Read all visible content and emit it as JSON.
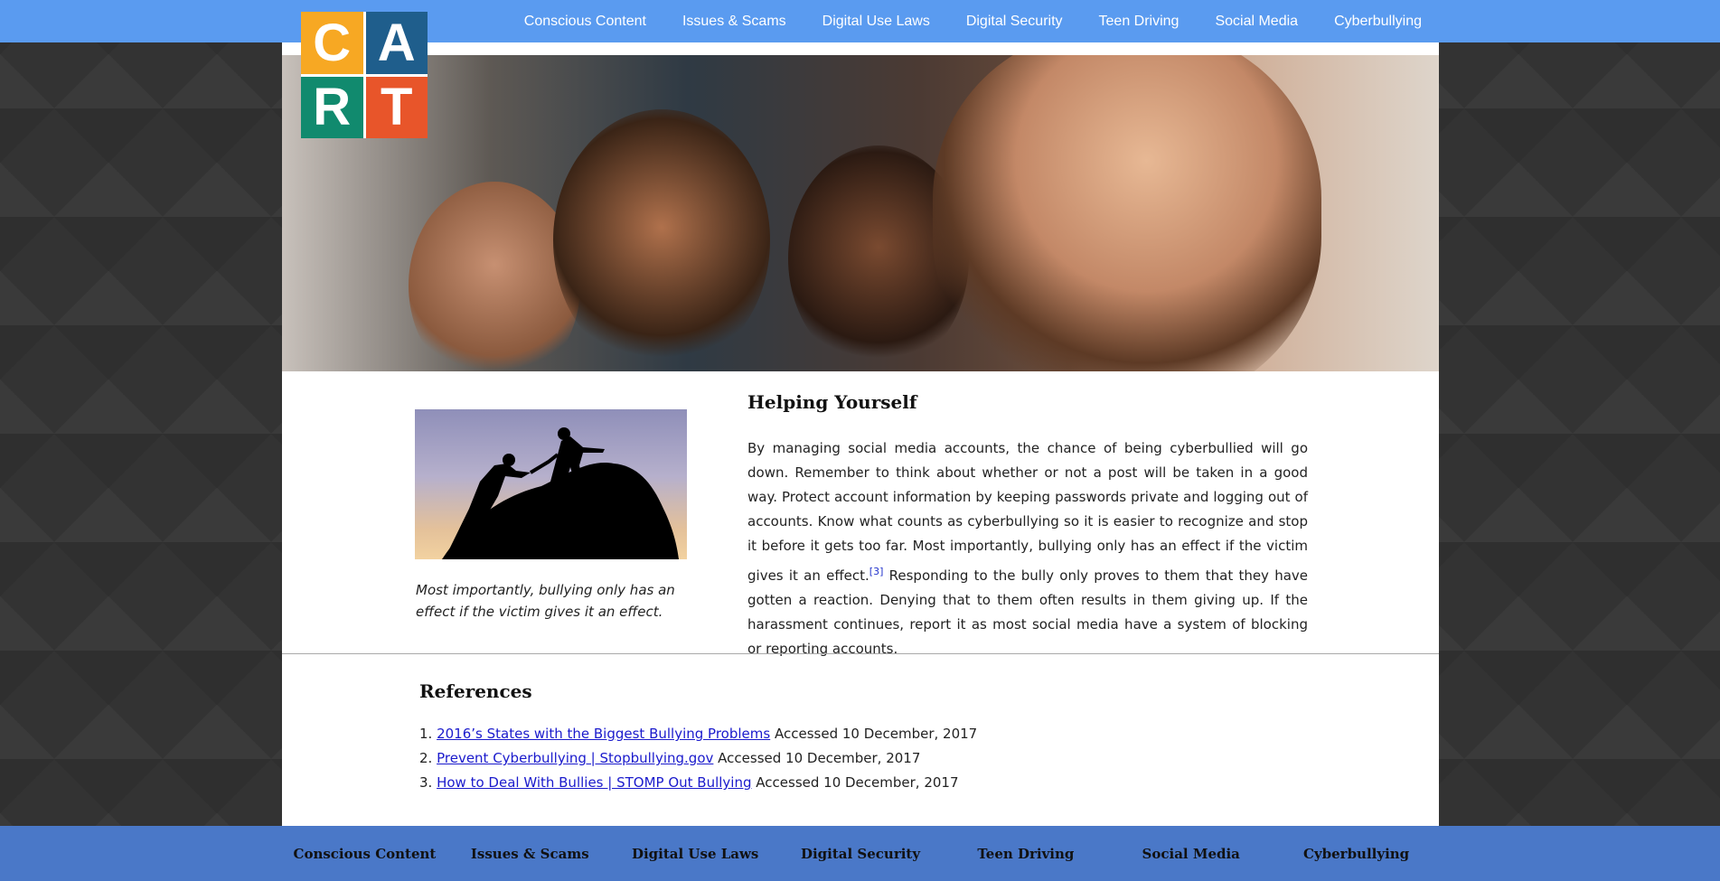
{
  "logo": {
    "letters": [
      "C",
      "A",
      "R",
      "T"
    ]
  },
  "nav": {
    "items": [
      "Conscious Content",
      "Issues & Scams",
      "Digital Use Laws",
      "Digital Security",
      "Teen Driving",
      "Social Media",
      "Cyberbullying"
    ]
  },
  "figure": {
    "caption": "Most importantly, bullying only has an effect if the victim gives it an effect."
  },
  "article": {
    "heading": "Helping Yourself",
    "text_before": "By managing social media accounts, the chance of being cyberbullied will go down. Remember to think about whether or not a post will be taken in a good way. Protect account information by keeping passwords private and logging out of accounts. Know what counts as cyberbullying so it is easier to recognize and stop it before it gets too far. Most importantly, bullying only has an effect if the victim gives it an effect.",
    "footnote": "[3]",
    "text_after": " Responding to the bully only proves to them that they have gotten a reaction. Denying that to them often results in them giving up. If the harassment continues, report it as most social media have a system of blocking or reporting accounts."
  },
  "references": {
    "heading": "References",
    "items": [
      {
        "num": "1.",
        "link": "2016’s States with the Biggest Bullying Problems",
        "accessed": "Accessed 10 December, 2017"
      },
      {
        "num": "2.",
        "link": "Prevent Cyberbullying | Stopbullying.gov",
        "accessed": "Accessed 10 December, 2017"
      },
      {
        "num": "3.",
        "link": "How to Deal With Bullies | STOMP Out Bullying",
        "accessed": "Accessed 10 December, 2017"
      }
    ]
  },
  "colors": {
    "top_nav_bg": "#5a9bf0",
    "bottom_nav_bg": "#4a78c8",
    "link": "#1a1acc",
    "logo_c": "#f7a823",
    "logo_a": "#1f5e8c",
    "logo_r": "#118a6e",
    "logo_t": "#e8552a"
  }
}
